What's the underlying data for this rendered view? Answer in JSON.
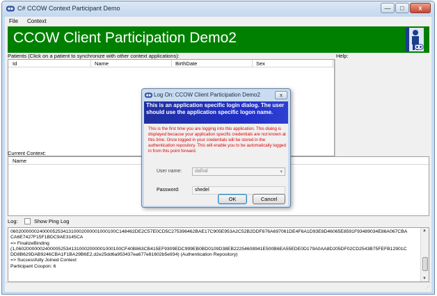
{
  "window": {
    "title": "C# CCOW Context Participant Demo",
    "buttons": {
      "minimize": "—",
      "maximize": "□",
      "close": "x"
    }
  },
  "menu": [
    "File",
    "Context"
  ],
  "banner": {
    "title": "CCOW Client Participation Demo2",
    "color": "#008000"
  },
  "patients": {
    "label": "Patients (Click on a patient to synchronize with other context applications):",
    "columns": [
      "Id",
      "Name",
      "BirthDate",
      "Sex"
    ]
  },
  "help": {
    "label": "Help:"
  },
  "current_context": {
    "label": "Current Context:",
    "columns": [
      "Name"
    ]
  },
  "log": {
    "label": "Log:",
    "show_ping_label": "Show Ping Log",
    "lines": [
      "0602000000240000525341310002000001000100C148462DE2C57E0CD5C275396462BAE17C905E953A2C52B2DDF876A697061DE4F6A1D93E8D46065E8591F93489034E86A067CBA",
      "CA6E7427F15F1BDC9AE3145CA",
      "=> FinalizeBinding",
      "(1,0602000000240000525341310002000001000100CF40B863CB415EF9309EDC999EB0BD0109D38EB22254608941E500B6EA55EDE0D179A0AA8D205DF02CD2543B75FEFB12901C",
      "DD8B629DAB9246CBA1F1BA29B6E2,d2e25dd6a953437ea677e81602b5e934) (Authentication Repository)",
      "=> Successfully Joined Context",
      "   Participant Coupon: 6"
    ]
  },
  "dialog": {
    "title": "Log On: CCOW Client Participation Demo2",
    "header": "This is an application specific login dialog.  The user should use the application specific logon name.",
    "description": "This is the first time you are logging into this application.  This dialog is displayed because your application specific credentials are not known at this time.  Once logged in your credentials will be stored in the authentication repository.  This will enable you to be automatically logged in from this point forward.",
    "username_label": "User name:",
    "username_value": "dalhal",
    "password_label": "Password:",
    "password_value": "shedel",
    "ok_label": "OK",
    "cancel_label": "Cancel",
    "close_glyph": "x"
  }
}
